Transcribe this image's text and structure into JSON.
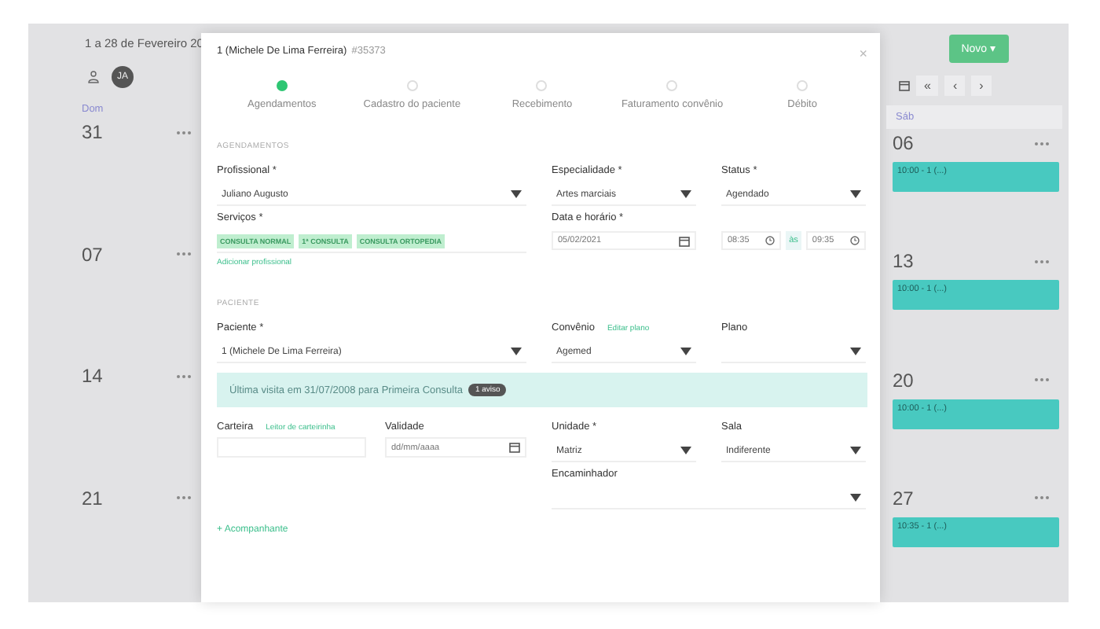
{
  "calendar": {
    "range_title": "1 a 28 de Fevereiro 20",
    "avatar": "JA",
    "new_button": "Novo",
    "new_caret": "▾",
    "nav_buttons": [
      "«",
      "‹",
      "›"
    ],
    "left_weekday": "Dom",
    "right_weekday": "Sáb",
    "left_days": [
      {
        "day": "31"
      },
      {
        "day": "07"
      },
      {
        "day": "14"
      },
      {
        "day": "21"
      }
    ],
    "right_days": [
      {
        "day": "06",
        "event": "10:00 - 1 (...)"
      },
      {
        "day": "13",
        "event": "10:00 - 1 (...)"
      },
      {
        "day": "20",
        "event": "10:00 - 1 (...)"
      },
      {
        "day": "27",
        "event": "10:35 - 1 (...)"
      }
    ]
  },
  "modal": {
    "title": "1 (Michele De Lima Ferreira)",
    "record_id": "#35373",
    "close": "×",
    "steps": [
      {
        "label": "Agendamentos",
        "selected": true
      },
      {
        "label": "Cadastro do paciente",
        "selected": false
      },
      {
        "label": "Recebimento",
        "selected": false
      },
      {
        "label": "Faturamento convênio",
        "selected": false
      },
      {
        "label": "Débito",
        "selected": false
      }
    ],
    "appointment_section": {
      "heading": "AGENDAMENTOS",
      "professional": {
        "label": "Profissional *",
        "value": "Juliano Augusto"
      },
      "specialty": {
        "label": "Especialidade *",
        "value": "Artes marciais"
      },
      "status": {
        "label": "Status *",
        "value": "Agendado"
      },
      "services": {
        "label": "Serviços *",
        "tags": [
          "CONSULTA NORMAL",
          "1ª CONSULTA",
          "CONSULTA ORTOPEDIA"
        ]
      },
      "datetime": {
        "label": "Data e horário *",
        "date": "05/02/2021",
        "start": "08:35",
        "separator": "às",
        "end": "09:35"
      },
      "add_link": "Adicionar profissional"
    },
    "patient_section": {
      "heading": "PACIENTE",
      "patient": {
        "label": "Paciente *",
        "value": "1 (Michele De Lima Ferreira)"
      },
      "insurance": {
        "label": "Convênio",
        "link": "Editar plano",
        "value": "Agemed"
      },
      "plan": {
        "label": "Plano"
      },
      "alert": {
        "text": "Última visita em 31/07/2008 para Primeira Consulta",
        "badge": "1 aviso"
      },
      "card": {
        "label": "Carteira",
        "link": "Leitor de carteirinha"
      },
      "validity": {
        "label": "Validade",
        "placeholder": "dd/mm/aaaa"
      },
      "unit": {
        "label": "Unidade *",
        "value": "Matriz"
      },
      "room": {
        "label": "Sala",
        "value": "Indiferente"
      },
      "referrer": {
        "label": "Encaminhador"
      },
      "companion_link": "+ Acompanhante"
    }
  }
}
